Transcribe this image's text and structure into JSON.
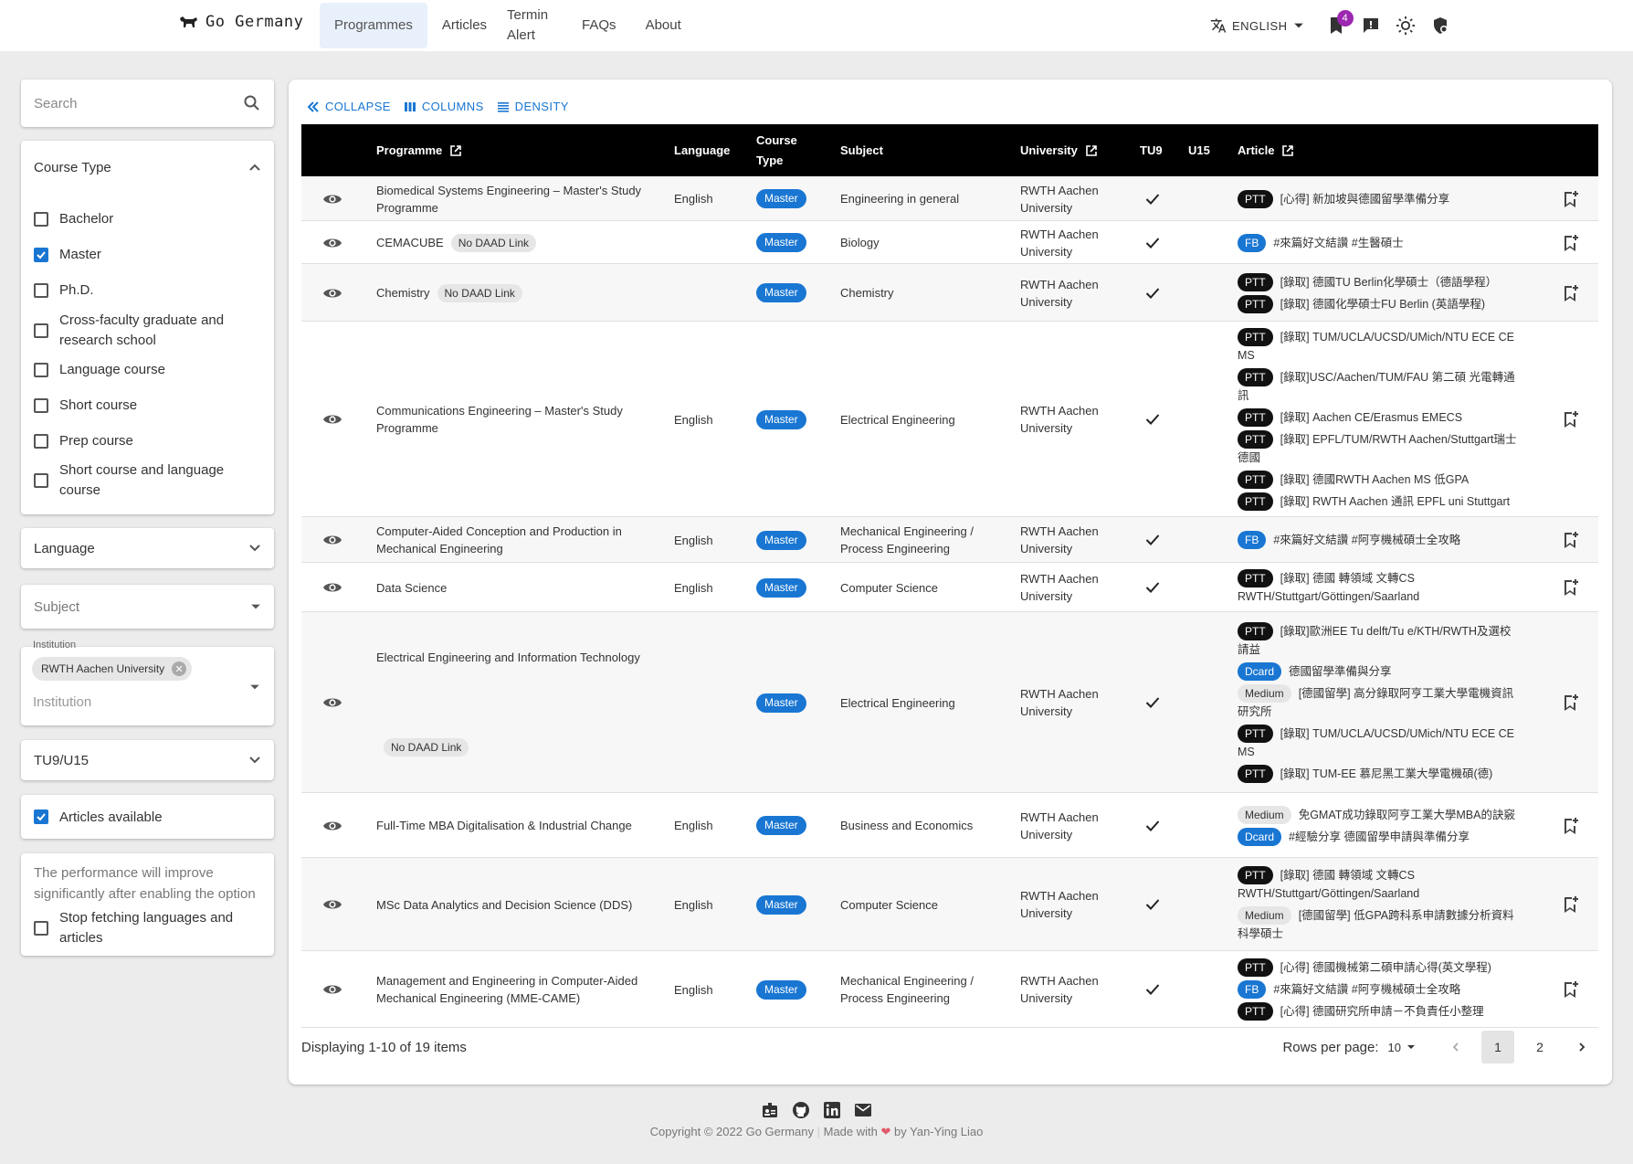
{
  "header": {
    "brand": "Go Germany",
    "nav": [
      {
        "label": "Programmes",
        "active": true
      },
      {
        "label": "Articles"
      },
      {
        "label": "Termin Alert"
      },
      {
        "label": "FAQs"
      },
      {
        "label": "About"
      }
    ],
    "language": "ENGLISH",
    "bookmark_count": "4"
  },
  "sidebar": {
    "search_placeholder": "Search",
    "course_type_title": "Course Type",
    "course_types": [
      {
        "label": "Bachelor",
        "checked": false
      },
      {
        "label": "Master",
        "checked": true
      },
      {
        "label": "Ph.D.",
        "checked": false
      },
      {
        "label": "Cross-faculty graduate and research school",
        "checked": false
      },
      {
        "label": "Language course",
        "checked": false
      },
      {
        "label": "Short course",
        "checked": false
      },
      {
        "label": "Prep course",
        "checked": false
      },
      {
        "label": "Short course and language course",
        "checked": false
      }
    ],
    "language_title": "Language",
    "subject_placeholder": "Subject",
    "institution_label": "Institution",
    "institution_chip": "RWTH Aachen University",
    "institution_placeholder": "Institution",
    "tu9_title": "TU9/U15",
    "articles_label": "Articles available",
    "perf_text": "The performance will improve significantly after enabling the option",
    "perf_option": "Stop fetching languages and articles"
  },
  "table": {
    "toolbar": {
      "collapse": "COLLAPSE",
      "columns": "COLUMNS",
      "density": "DENSITY"
    },
    "headers": {
      "programme": "Programme",
      "language": "Language",
      "course_type": "Course Type",
      "subject": "Subject",
      "university": "University",
      "tu9": "TU9",
      "u15": "U15",
      "article": "Article"
    },
    "rows": [
      {
        "programme": "Biomedical Systems Engineering – Master's Study Programme",
        "no_daad": "",
        "language": "English",
        "type": "Master",
        "subject": "Engineering in general",
        "university": "RWTH Aachen University",
        "articles": [
          {
            "tag": "PTT",
            "text": "[心得] 新加坡與德國留學準備分享"
          }
        ]
      },
      {
        "programme": "CEMACUBE",
        "no_daad": "No DAAD Link",
        "language": "",
        "type": "Master",
        "subject": "Biology",
        "university": "RWTH Aachen University",
        "articles": [
          {
            "tag": "FB",
            "text": "#來篇好文結讚 #生醫碩士"
          }
        ]
      },
      {
        "programme": "Chemistry",
        "no_daad": "No DAAD Link",
        "language": "",
        "type": "Master",
        "subject": "Chemistry",
        "university": "RWTH Aachen University",
        "articles": [
          {
            "tag": "PTT",
            "text": "[錄取] 德國TU Berlin化學碩士（德語學程）"
          },
          {
            "tag": "PTT",
            "text": "[錄取] 德國化學碩士FU Berlin (英語學程)"
          }
        ]
      },
      {
        "programme": "Communications Engineering – Master's Study Programme",
        "no_daad": "",
        "language": "English",
        "type": "Master",
        "subject": "Electrical Engineering",
        "university": "RWTH Aachen University",
        "articles": [
          {
            "tag": "PTT",
            "text": "[錄取] TUM/UCLA/UCSD/UMich/NTU ECE CE MS"
          },
          {
            "tag": "PTT",
            "text": "[錄取]USC/Aachen/TUM/FAU 第二碩 光電轉通訊"
          },
          {
            "tag": "PTT",
            "text": "[錄取] Aachen CE/Erasmus EMECS"
          },
          {
            "tag": "PTT",
            "text": "[錄取] EPFL/TUM/RWTH Aachen/Stuttgart瑞士德國"
          },
          {
            "tag": "PTT",
            "text": "[錄取] 德國RWTH Aachen MS 低GPA"
          },
          {
            "tag": "PTT",
            "text": "[錄取] RWTH Aachen 通訊 EPFL uni Stuttgart"
          }
        ]
      },
      {
        "programme": "Computer-Aided Conception and Production in Mechanical Engineering",
        "no_daad": "",
        "language": "English",
        "type": "Master",
        "subject": "Mechanical Engineering / Process Engineering",
        "university": "RWTH Aachen University",
        "articles": [
          {
            "tag": "FB",
            "text": "#來篇好文結讚 #阿亨機械碩士全攻略"
          }
        ]
      },
      {
        "programme": "Data Science",
        "no_daad": "",
        "language": "English",
        "type": "Master",
        "subject": "Computer Science",
        "university": "RWTH Aachen University",
        "articles": [
          {
            "tag": "PTT",
            "text": "[錄取] 德國 轉領域 文轉CS RWTH/Stuttgart/Göttingen/Saarland"
          }
        ]
      },
      {
        "programme": "Electrical Engineering and Information Technology",
        "no_daad": "No DAAD Link",
        "language": "",
        "type": "Master",
        "subject": "Electrical Engineering",
        "university": "RWTH Aachen University",
        "articles": [
          {
            "tag": "PTT",
            "text": "[錄取]歐洲EE Tu delft/Tu e/KTH/RWTH及選校請益"
          },
          {
            "tag": "Dcard",
            "text": "德國留學準備與分享"
          },
          {
            "tag": "Medium",
            "text": "[德國留學] 高分錄取阿亨工業大學電機資訊研究所"
          },
          {
            "tag": "PTT",
            "text": "[錄取] TUM/UCLA/UCSD/UMich/NTU ECE CE MS"
          },
          {
            "tag": "PTT",
            "text": "[錄取] TUM-EE 慕尼黑工業大學電機碩(德)"
          }
        ]
      },
      {
        "programme": "Full-Time MBA Digitalisation & Industrial Change",
        "no_daad": "",
        "language": "English",
        "type": "Master",
        "subject": "Business and Economics",
        "university": "RWTH Aachen University",
        "articles": [
          {
            "tag": "Medium",
            "text": "免GMAT成功錄取阿亨工業大學MBA的訣竅"
          },
          {
            "tag": "Dcard",
            "text": "#經驗分享 德國留學申請與準備分享"
          }
        ]
      },
      {
        "programme": "MSc Data Analytics and Decision Science (DDS)",
        "no_daad": "",
        "language": "English",
        "type": "Master",
        "subject": "Computer Science",
        "university": "RWTH Aachen University",
        "articles": [
          {
            "tag": "PTT",
            "text": "[錄取] 德國 轉領域 文轉CS RWTH/Stuttgart/Göttingen/Saarland"
          },
          {
            "tag": "Medium",
            "text": "[德國留學] 低GPA跨科系申請數據分析資料科學碩士"
          }
        ]
      },
      {
        "programme": "Management and Engineering in Computer-Aided Mechanical Engineering (MME-CAME)",
        "no_daad": "",
        "language": "English",
        "type": "Master",
        "subject": "Mechanical Engineering / Process Engineering",
        "university": "RWTH Aachen University",
        "articles": [
          {
            "tag": "PTT",
            "text": "[心得] 德國機械第二碩申請心得(英文學程)"
          },
          {
            "tag": "FB",
            "text": "#來篇好文結讚 #阿亨機械碩士全攻略"
          },
          {
            "tag": "PTT",
            "text": "[心得] 德國研究所申請－不負責任小整理"
          }
        ]
      }
    ],
    "displaying": "Displaying 1-10 of 19 items",
    "rows_per_page_label": "Rows per page:",
    "rows_per_page": "10",
    "pages": [
      "1",
      "2"
    ]
  },
  "footer": {
    "copyright": "Copyright © 2022 Go Germany",
    "made_with": "Made with",
    "author": "by Yan-Ying Liao"
  },
  "colors": {
    "accent": "#1976d2",
    "badge": "#9c27b0",
    "header_bg": "#000000"
  }
}
